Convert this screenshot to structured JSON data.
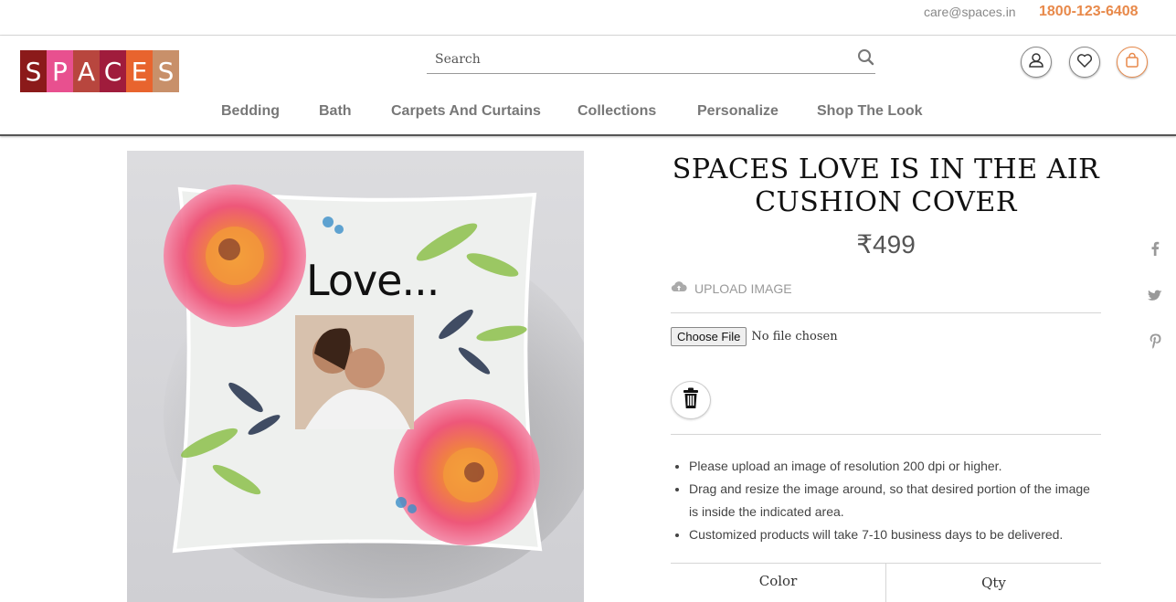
{
  "topbar": {
    "email": "care@spaces.in",
    "phone": "1800-123-6408"
  },
  "header": {
    "logo_letters": [
      "S",
      "P",
      "A",
      "C",
      "E",
      "S"
    ],
    "logo_colors": [
      "#8b1a1a",
      "#e8508f",
      "#b8463e",
      "#a01c3c",
      "#e8642e",
      "#c8906a"
    ],
    "search": {
      "placeholder": "Search"
    },
    "nav": [
      "Bedding",
      "Bath",
      "Carpets And Curtains",
      "Collections",
      "Personalize",
      "Shop The Look"
    ]
  },
  "product": {
    "image_text": "Love...",
    "title": "SPACES LOVE IS IN THE AIR CUSHION COVER",
    "price": "₹499",
    "upload_label": "UPLOAD IMAGE",
    "file_button": "Choose File",
    "file_status": "No file chosen",
    "notes": [
      "Please upload an image of resolution 200 dpi or higher.",
      "Drag and resize the image around, so that desired portion of the image is inside the indicated area.",
      "Customized products will take 7-10 business days to be delivered."
    ],
    "tabs": {
      "color": "Color",
      "qty": "Qty"
    }
  },
  "colors": {
    "accent_orange": "#e8894a",
    "nav_text": "#777777"
  }
}
